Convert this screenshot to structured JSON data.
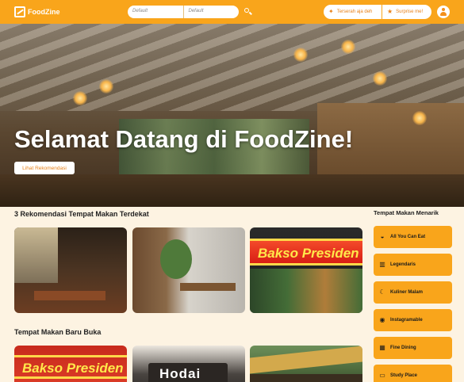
{
  "header": {
    "brand": "FoodZine",
    "search": {
      "field1_placeholder": "Default",
      "field2_placeholder": "Default"
    },
    "nearby_button": "Terserah aja deh",
    "surprise_button": "Surprise me!"
  },
  "hero": {
    "title": "Selamat Datang di FoodZine!",
    "cta": "Lihat Rekomendasi"
  },
  "sections": {
    "recommended_title": "3 Rekomendasi Tempat Makan Terdekat",
    "new_title": "Tempat Makan Baru Buka"
  },
  "cards": {
    "bakso_sign": "Bakso Presiden",
    "hodai_sign": "Hodai"
  },
  "sidebar": {
    "title": "Tempat Makan Menarik",
    "items": [
      {
        "label": "All You Can Eat",
        "icon": "bowl-icon"
      },
      {
        "label": "Legendaris",
        "icon": "book-icon"
      },
      {
        "label": "Kuliner Malam",
        "icon": "moon-icon"
      },
      {
        "label": "Instagramable",
        "icon": "camera-icon"
      },
      {
        "label": "Fine Dining",
        "icon": "dining-icon"
      },
      {
        "label": "Study Place",
        "icon": "laptop-icon"
      }
    ]
  },
  "colors": {
    "accent": "#f9a51b",
    "background": "#fdf3e2"
  }
}
